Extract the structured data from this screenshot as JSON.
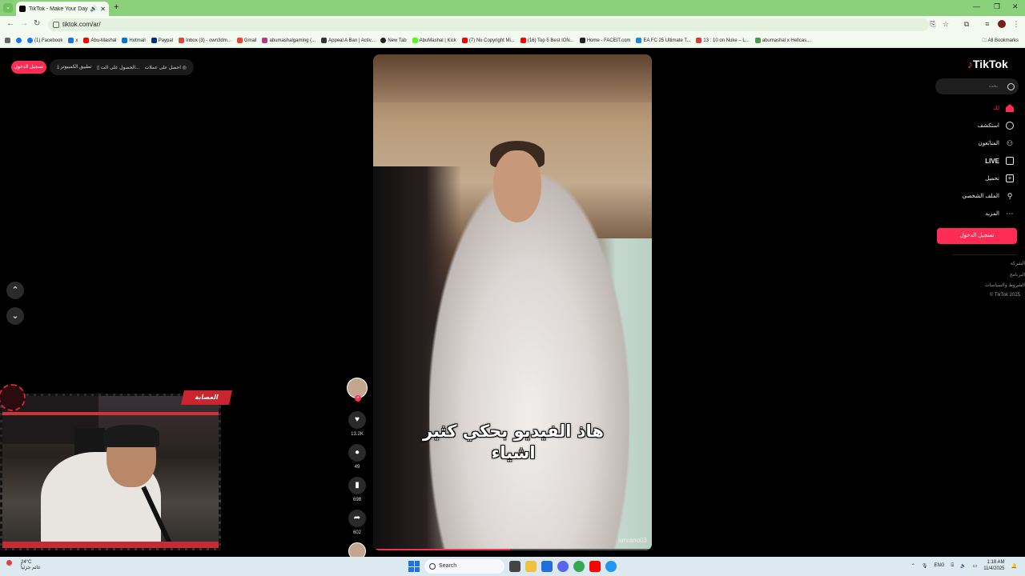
{
  "browser": {
    "tab_title": "TikTok - Make Your Day",
    "tab_menu_icon": "chevron-down-icon",
    "new_tab": "+",
    "minimize": "—",
    "maximize": "❐",
    "close": "✕",
    "url": "tiktok.com/ar/",
    "back": "←",
    "forward": "→",
    "reload": "↻",
    "bookmarks": [
      "(1) Facebook",
      "x",
      "Abu-Mashal",
      "Hotmail",
      "Paypal",
      "Inbox (3) - own3dm...",
      "Gmail",
      "abumashalgaming (...",
      "Appeal A Ban | Activ...",
      "New Tab",
      "AbuMashal | Kick",
      "(7) No Copyright Mi...",
      "(16) Top 5 Best ION...",
      "Home - FACEIT.com",
      "EA FC 25 Ultimate T...",
      "13 : 10 on Nuke – L...",
      "abumashal x Hellcas..."
    ],
    "all_bookmarks": "All Bookmarks"
  },
  "header": {
    "login_top": "تسجيل الدخول",
    "get_coins": "احصل على عملات",
    "get_app": "الحصول على الت...",
    "desktop_app": "تطبيق الكمبيوتر"
  },
  "feed": {
    "caption_line1": "هاذ الفيديو بحكي كثير",
    "caption_line2": "اشياء",
    "watermark": "amrano03",
    "progress": 0.49,
    "likes": "13.2K",
    "comments": "49",
    "saves": "698",
    "shares": "602"
  },
  "sidebar": {
    "logo": "TikTok",
    "search_placeholder": "بحث",
    "items": [
      {
        "label": "لك",
        "icon": "home-icon"
      },
      {
        "label": "استكشف",
        "icon": "compass-icon"
      },
      {
        "label": "المتابَعون",
        "icon": "following-icon"
      },
      {
        "label": "LIVE",
        "icon": "live-icon"
      },
      {
        "label": "تحميل",
        "icon": "upload-icon"
      },
      {
        "label": "الملف الشخصي",
        "icon": "profile-icon"
      },
      {
        "label": "المزيد",
        "icon": "more-icon"
      }
    ],
    "login": "تسجيل الدخول",
    "footer": [
      "الشركة",
      "البرنامج",
      "الشروط والسياسات",
      "© TikTok 2025"
    ]
  },
  "overlay": {
    "badge": "العصابة"
  },
  "taskbar": {
    "temperature": "24°C",
    "weather": "غائم جزئياً",
    "search": "Search",
    "lang": "ENG",
    "time": "1:18 AM",
    "date": "11/4/2025"
  },
  "colors": {
    "accent": "#fe2c55",
    "chrome": "#8bd07a"
  }
}
